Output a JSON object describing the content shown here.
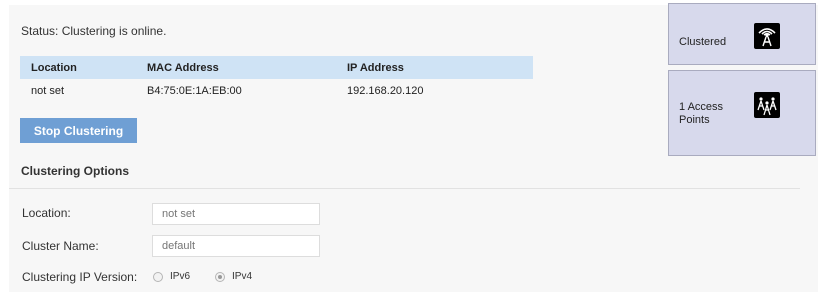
{
  "status_text": "Status: Clustering is online.",
  "table": {
    "headers": [
      "Location",
      "MAC Address",
      "IP Address"
    ],
    "rows": [
      [
        "not set",
        "B4:75:0E:1A:EB:00",
        "192.168.20.120"
      ]
    ]
  },
  "stop_button_label": "Stop Clustering",
  "options": {
    "title": "Clustering Options",
    "location_label": "Location:",
    "location_placeholder": "not set",
    "cluster_name_label": "Cluster Name:",
    "cluster_name_placeholder": "default",
    "ip_version_label": "Clustering IP Version:",
    "ip_version_options": [
      "IPv6",
      "IPv4"
    ],
    "ip_version_selected": "IPv4"
  },
  "cards": {
    "clustered_label": "Clustered",
    "clustered_icon": "wireless-tower-icon",
    "access_points_label_line1": "1 Access",
    "access_points_label_line2": "Points",
    "access_points_icon": "access-points-icon"
  },
  "colors": {
    "table_header_bg": "#cfe3f5",
    "button_bg": "#6f9fd4",
    "card_bg": "#d7d9ec",
    "card_border": "#a9abbf"
  }
}
